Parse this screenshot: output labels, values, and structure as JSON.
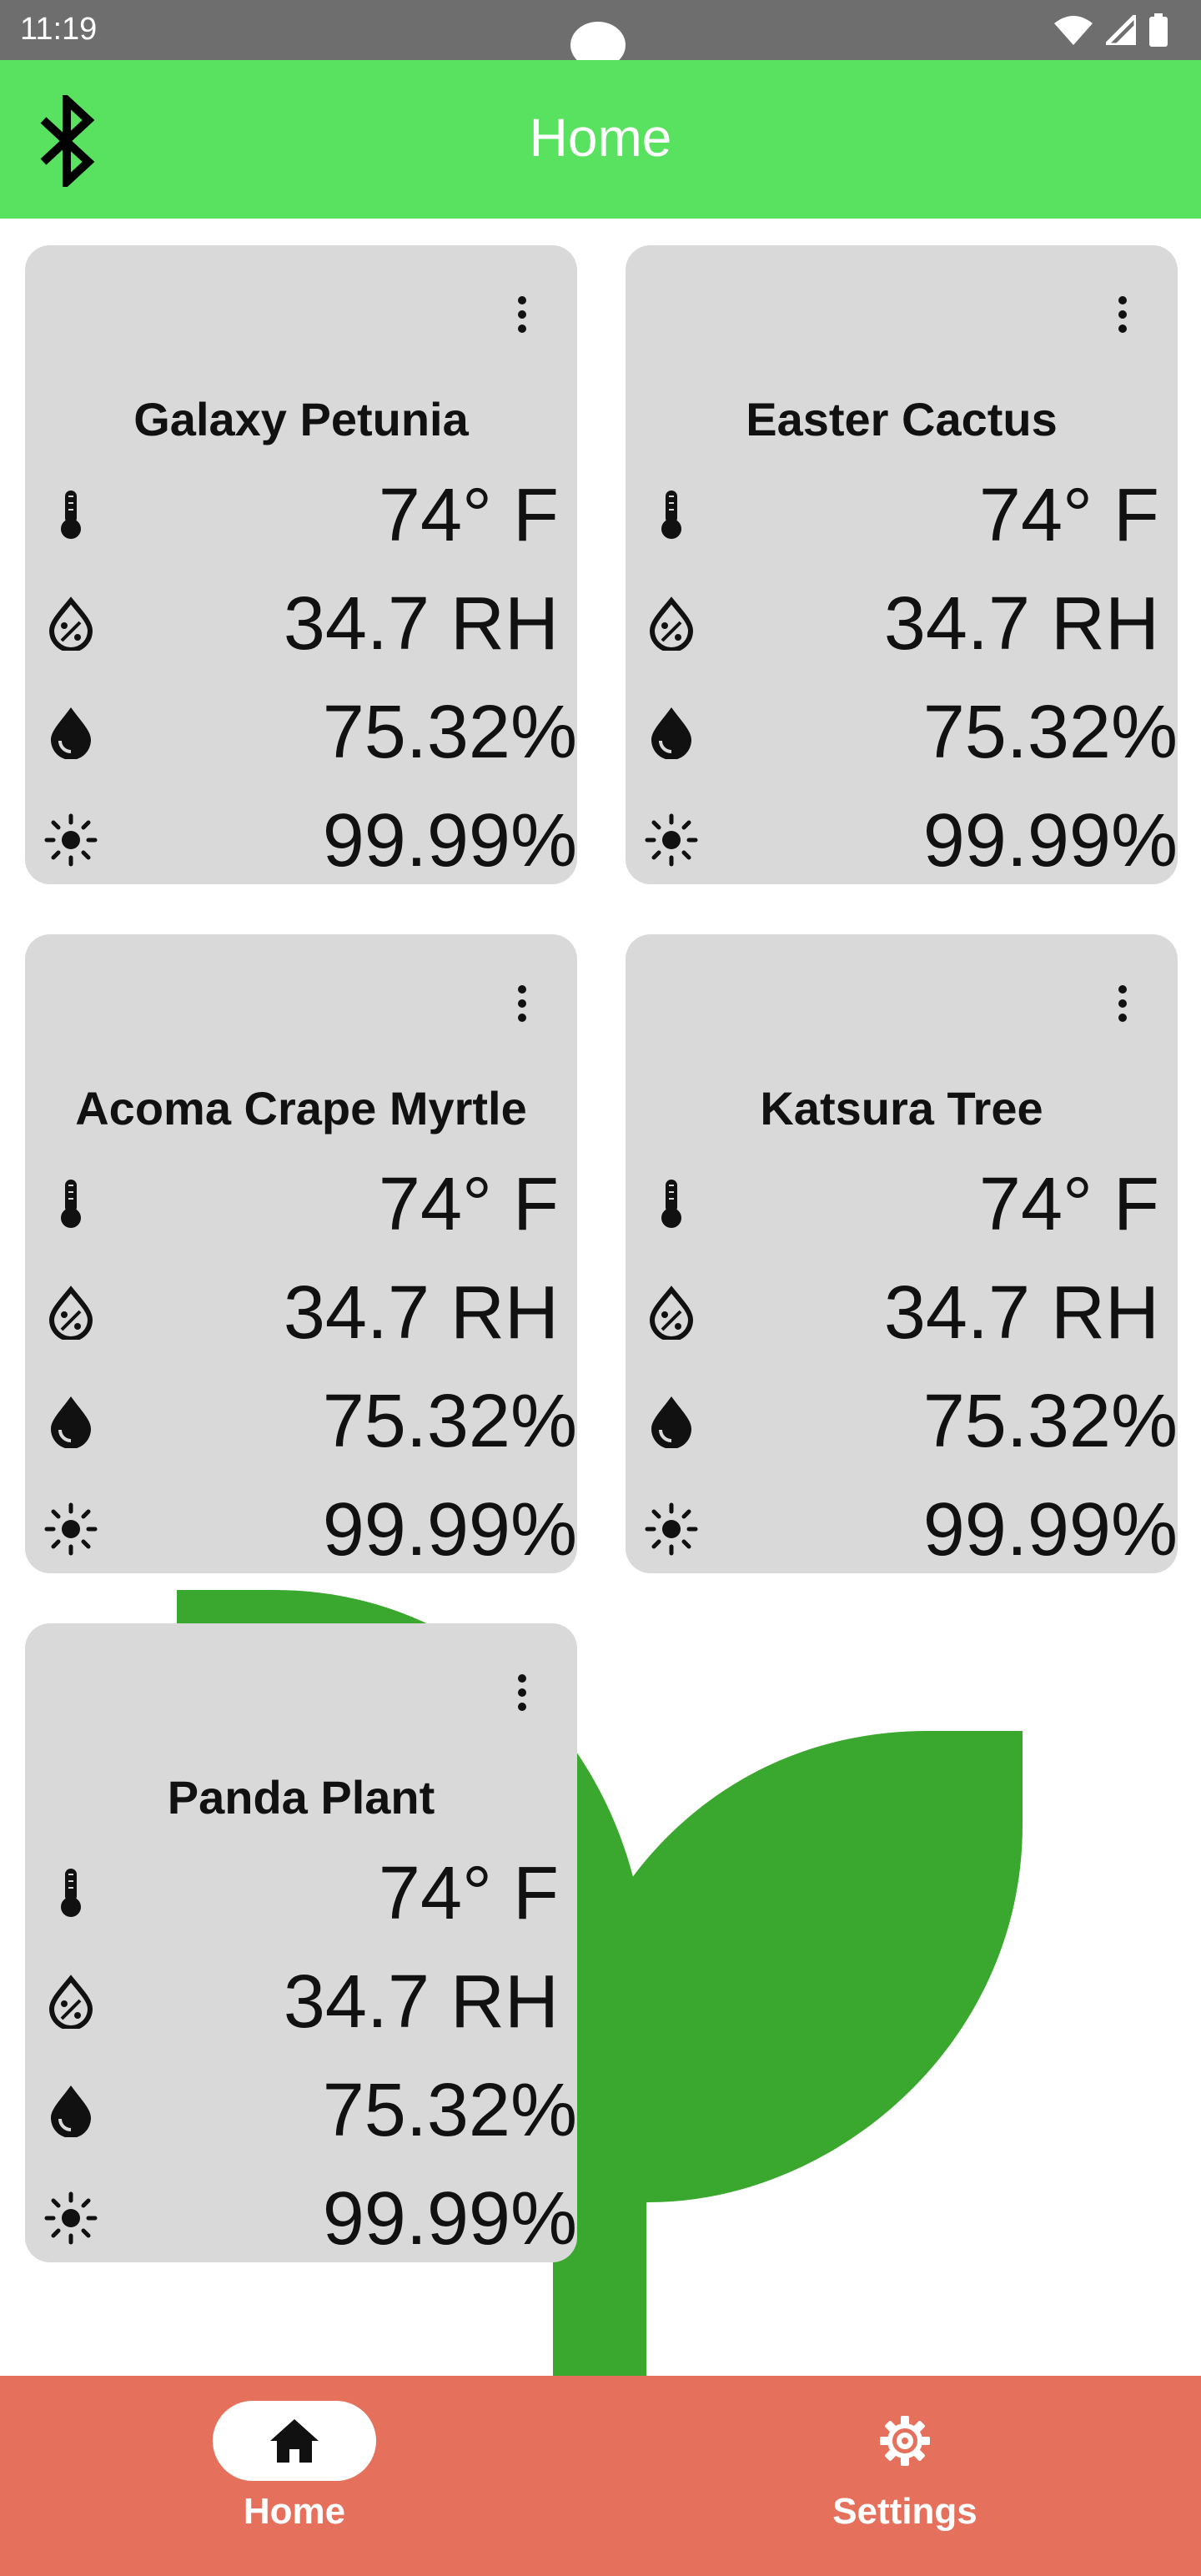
{
  "status_bar": {
    "time": "11:19"
  },
  "app_bar": {
    "title": "Home"
  },
  "plants": [
    {
      "name": "Galaxy Petunia",
      "temperature": "74° F",
      "humidity": "34.7 RH",
      "moisture": "75.32%",
      "light": "99.99%"
    },
    {
      "name": "Easter Cactus",
      "temperature": "74° F",
      "humidity": "34.7 RH",
      "moisture": "75.32%",
      "light": "99.99%"
    },
    {
      "name": "Acoma Crape Myrtle",
      "temperature": "74° F",
      "humidity": "34.7 RH",
      "moisture": "75.32%",
      "light": "99.99%"
    },
    {
      "name": "Katsura Tree",
      "temperature": "74° F",
      "humidity": "34.7 RH",
      "moisture": "75.32%",
      "light": "99.99%"
    },
    {
      "name": "Panda Plant",
      "temperature": "74° F",
      "humidity": "34.7 RH",
      "moisture": "75.32%",
      "light": "99.99%"
    }
  ],
  "bottom_nav": {
    "items": [
      {
        "label": "Home",
        "icon": "home-icon",
        "selected": true
      },
      {
        "label": "Settings",
        "icon": "gear-icon",
        "selected": false
      }
    ]
  },
  "colors": {
    "app_bar": "#59e160",
    "bottom_nav": "#e5705c",
    "card": "#d9d9d9",
    "plant_logo": "#3aa82e"
  }
}
